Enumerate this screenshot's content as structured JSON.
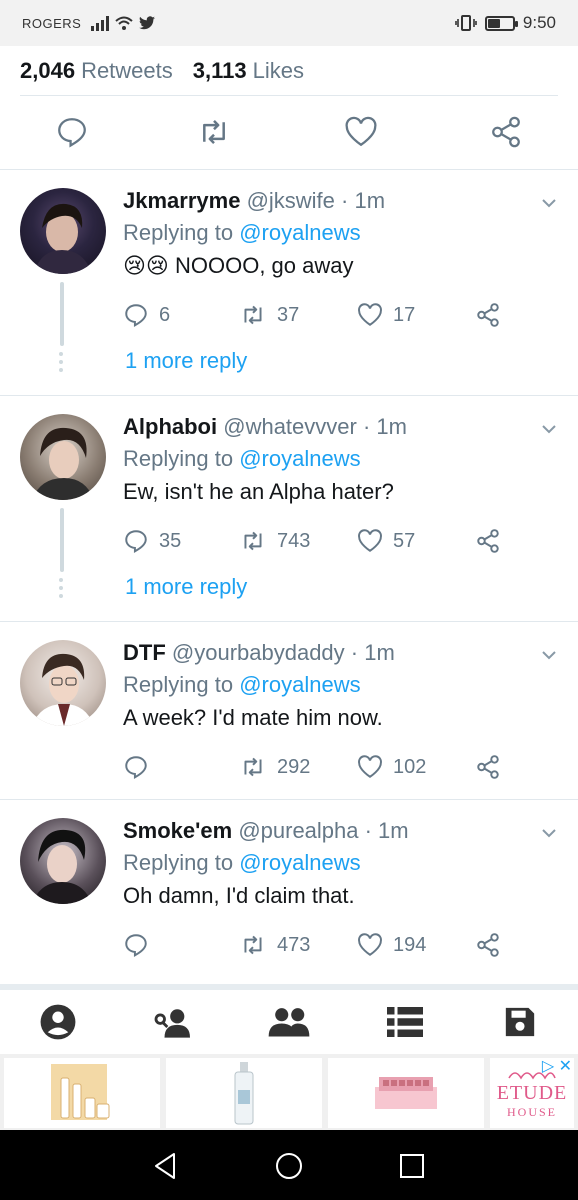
{
  "status": {
    "carrier": "ROGERS",
    "time": "9:50",
    "battery_level": 0.45
  },
  "stats": {
    "retweets_count": "2,046",
    "retweets_label": "Retweets",
    "likes_count": "3,113",
    "likes_label": "Likes"
  },
  "replies": [
    {
      "name": "Jkmarryme",
      "handle": "@jkswife · 1m",
      "replying_prefix": "Replying to",
      "replying_to": "@royalnews",
      "emoji": "😢😢",
      "text": "NOOOO, go away",
      "reply_count": "6",
      "retweet_count": "37",
      "like_count": "17",
      "more": "1 more reply"
    },
    {
      "name": "Alphaboi",
      "handle": "@whatevvver · 1m",
      "replying_prefix": "Replying to",
      "replying_to": "@royalnews",
      "text": "Ew, isn't he an Alpha hater?",
      "reply_count": "35",
      "retweet_count": "743",
      "like_count": "57",
      "more": "1 more reply"
    },
    {
      "name": "DTF",
      "handle": "@yourbabydaddy · 1m",
      "replying_prefix": "Replying to",
      "replying_to": "@royalnews",
      "text": "A week? I'd mate him now.",
      "reply_count": "",
      "retweet_count": "292",
      "like_count": "102"
    },
    {
      "name": "Smoke'em",
      "handle": "@purealpha · 1m",
      "replying_prefix": "Replying to",
      "replying_to": "@royalnews",
      "text": "Oh damn, I'd claim that.",
      "reply_count": "",
      "retweet_count": "473",
      "like_count": "194"
    }
  ],
  "ad": {
    "brand": "ETUDE",
    "brand_sub": "HOUSE"
  },
  "colors": {
    "accent": "#1da1f2",
    "muted": "#657786",
    "text": "#14171a"
  }
}
